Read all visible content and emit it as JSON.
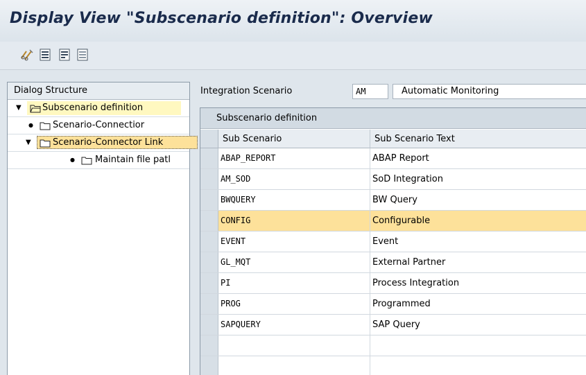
{
  "window": {
    "title": "Display View \"Subscenario definition\": Overview"
  },
  "toolbar": {
    "buttons": [
      {
        "icon": "edit-glasses-icon",
        "label": ""
      },
      {
        "icon": "select-all-icon",
        "label": ""
      },
      {
        "icon": "select-block-icon",
        "label": ""
      },
      {
        "icon": "deselect-all-icon",
        "label": ""
      }
    ]
  },
  "dialog_structure": {
    "header": "Dialog Structure",
    "items": [
      {
        "label": "Subscenario definition",
        "expanded": true,
        "selected": true
      },
      {
        "label": "Scenario-Connectior",
        "expanded": false,
        "selected": false
      },
      {
        "label": "Scenario-Connector Link",
        "expanded": true,
        "selected": false
      },
      {
        "label": "Maintain file patl",
        "expanded": false,
        "selected": false
      }
    ]
  },
  "scenario": {
    "label": "Integration Scenario",
    "code": "AM",
    "text": "Automatic Monitoring"
  },
  "table": {
    "title": "Subscenario definition",
    "columns": [
      "Sub Scenario",
      "Sub Scenario Text"
    ],
    "rows": [
      {
        "code": "ABAP_REPORT",
        "text": "ABAP Report"
      },
      {
        "code": "AM_SOD",
        "text": "SoD Integration"
      },
      {
        "code": "BWQUERY",
        "text": "BW Query"
      },
      {
        "code": "CONFIG",
        "text": "Configurable"
      },
      {
        "code": "EVENT",
        "text": "Event"
      },
      {
        "code": "GL_MQT",
        "text": "External Partner"
      },
      {
        "code": "PI",
        "text": "Process Integration"
      },
      {
        "code": "PROG",
        "text": "Programmed"
      },
      {
        "code": "SAPQUERY",
        "text": "SAP Query"
      },
      {
        "code": "",
        "text": ""
      },
      {
        "code": "",
        "text": ""
      }
    ],
    "selected_row": "CONFIG"
  },
  "colors": {
    "title_text": "#1a2b4c",
    "selected_row": "#fde19a",
    "tree_selected": "#fff8c0"
  }
}
